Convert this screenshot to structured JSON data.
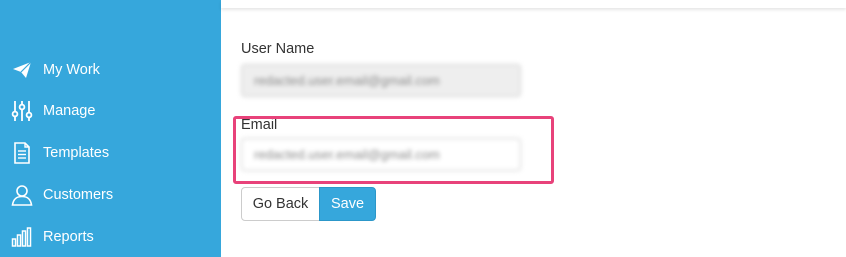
{
  "sidebar": {
    "items": [
      {
        "label": "My Work",
        "icon": "paper-plane-icon"
      },
      {
        "label": "Manage",
        "icon": "sliders-icon"
      },
      {
        "label": "Templates",
        "icon": "document-icon"
      },
      {
        "label": "Customers",
        "icon": "user-icon"
      },
      {
        "label": "Reports",
        "icon": "bar-chart-icon"
      }
    ]
  },
  "form": {
    "username_label": "User Name",
    "username_value": "redacted.user.email@gmail.com",
    "email_label": "Email",
    "email_value": "redacted.user.email@gmail.com"
  },
  "buttons": {
    "back_label": "Go Back",
    "save_label": "Save"
  },
  "colors": {
    "sidebar": "#36a7dc",
    "accent": "#36a7dc",
    "highlight": "#e8427a"
  }
}
